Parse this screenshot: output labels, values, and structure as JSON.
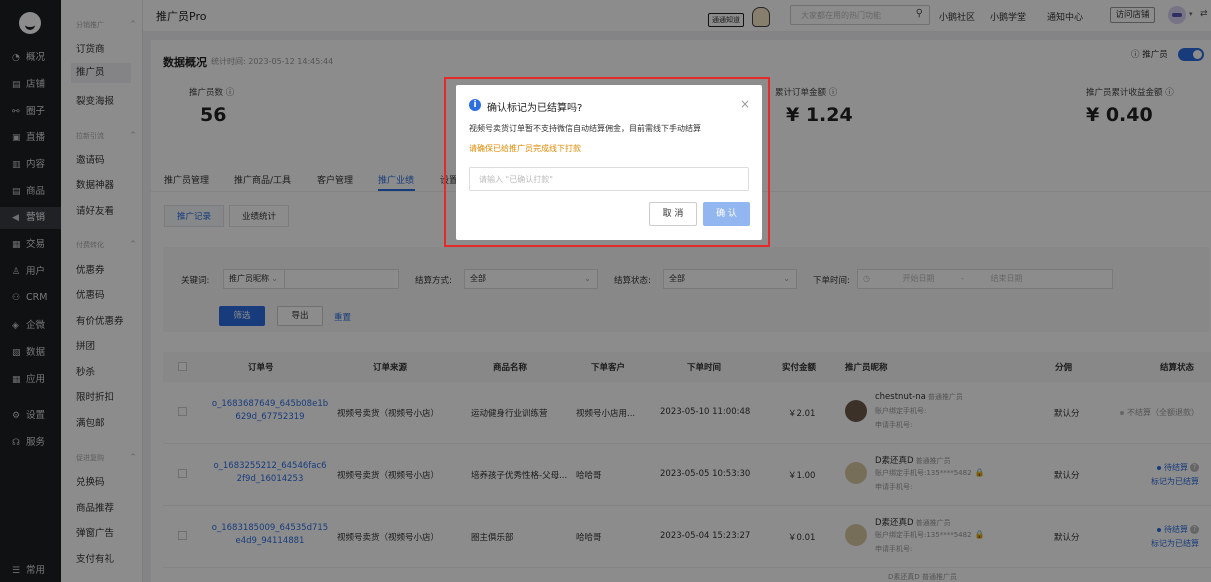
{
  "nav1": {
    "items": [
      {
        "icon": "◔",
        "label": "概况"
      },
      {
        "icon": "▤",
        "label": "店铺"
      },
      {
        "icon": "⚯",
        "label": "圈子"
      },
      {
        "icon": "▣",
        "label": "直播"
      },
      {
        "icon": "▥",
        "label": "内容"
      },
      {
        "icon": "▤",
        "label": "商品"
      },
      {
        "icon": "◀",
        "label": "营销"
      },
      {
        "icon": "▦",
        "label": "交易"
      },
      {
        "icon": "♙",
        "label": "用户"
      },
      {
        "icon": "⚇",
        "label": "CRM"
      },
      {
        "icon": "◈",
        "label": "企微"
      },
      {
        "icon": "▧",
        "label": "数据"
      },
      {
        "icon": "▦",
        "label": "应用"
      },
      {
        "icon": "⚙",
        "label": "设置"
      },
      {
        "icon": "☊",
        "label": "服务"
      }
    ],
    "bottom": {
      "icon": "☰",
      "label": "常用"
    }
  },
  "nav2": {
    "groups": [
      {
        "title": "分销推广",
        "items": [
          "订货商",
          "推广员",
          "裂变海报"
        ]
      },
      {
        "title": "拉新引流",
        "items": [
          "邀请码",
          "数据神器",
          "请好友看"
        ]
      },
      {
        "title": "付费转化",
        "items": [
          "优惠券",
          "优惠码",
          "有价优惠券",
          "拼团",
          "秒杀",
          "限时折扣",
          "满包邮"
        ]
      },
      {
        "title": "促进复购",
        "items": [
          "兑换码",
          "商品推荐",
          "弹窗广告",
          "支付有礼"
        ]
      }
    ],
    "caret": "^"
  },
  "header": {
    "title": "推广员Pro",
    "badge": "通通知道",
    "search_placeholder": "大家都在用的热门功能",
    "links": [
      "小鹅社区",
      "小鹅学堂",
      "通知中心"
    ],
    "visit_store": "访问店铺"
  },
  "overview": {
    "title": "数据概况",
    "stat_time": "统计时间: 2023-05-12 14:45:44",
    "toggle_label": "推广员",
    "stats": [
      {
        "label": "推广员数",
        "value": "56"
      },
      {
        "label": "累计订单金额",
        "value": "¥ 1.24"
      },
      {
        "label": "推广员累计收益金额",
        "value": "¥ 0.40"
      }
    ]
  },
  "tabs": [
    "推广员管理",
    "推广商品/工具",
    "客户管理",
    "推广业绩",
    "设置"
  ],
  "subtabs": [
    "推广记录",
    "业绩统计"
  ],
  "filters": {
    "keyword_label": "关键词:",
    "keyword_type": "推广员昵称",
    "settle_way_label": "结算方式:",
    "settle_way_value": "全部",
    "settle_status_label": "结算状态:",
    "settle_status_value": "全部",
    "order_time_label": "下单时间:",
    "start_placeholder": "开始日期",
    "end_placeholder": "结束日期",
    "search_btn": "筛选",
    "export_btn": "导出",
    "reset_link": "重置"
  },
  "table": {
    "headers": [
      "订单号",
      "订单来源",
      "商品名称",
      "下单客户",
      "下单时间",
      "实付金额",
      "推广员昵称",
      "分佣",
      "结算状态"
    ],
    "rows": [
      {
        "order_line1": "o_1683687649_645b08e1b",
        "order_line2": "629d_67752319",
        "source": "视频号卖货（视频号小店）",
        "product": "运动健身行业训练营",
        "customer": "视频号小店用...",
        "time": "2023-05-10 11:00:48",
        "amount": "￥2.01",
        "promoter": "chestnut-na",
        "promoter_type": "普通推广员",
        "bind_phone": "账户绑定手机号:",
        "apply_phone": "申请手机号:",
        "commission": "默认分",
        "status": "不结算（全额退款）",
        "mark": ""
      },
      {
        "order_line1": "o_1683255212_64546fac6",
        "order_line2": "2f9d_16014253",
        "source": "视频号卖货（视频号小店）",
        "product": "培养孩子优秀性格-父母...",
        "customer": "哈哈哥",
        "time": "2023-05-05 10:53:30",
        "amount": "￥1.00",
        "promoter": "D素还真D",
        "promoter_type": "普通推广员",
        "bind_phone": "账户绑定手机号:135****5482",
        "apply_phone": "申请手机号:",
        "commission": "默认分",
        "status": "待结算",
        "mark": "标记为已结算"
      },
      {
        "order_line1": "o_1683185009_64535d715",
        "order_line2": "e4d9_94114881",
        "source": "视频号卖货（视频号小店）",
        "product": "圈主俱乐部",
        "customer": "哈哈哥",
        "time": "2023-05-04 15:23:27",
        "amount": "￥0.01",
        "promoter": "D素还真D",
        "promoter_type": "普通推广员",
        "bind_phone": "账户绑定手机号:135****5482",
        "apply_phone": "申请手机号:",
        "commission": "默认分",
        "status": "待结算",
        "mark": "标记为已结算"
      }
    ],
    "partial_row_promoter": "D素还真D 普通推广员"
  },
  "modal": {
    "title": "确认标记为已结算吗?",
    "desc": "视频号卖货订单暂不支持微信自动结算佣金，目前需线下手动结算",
    "warn": "请确保已给推广员完成线下打款",
    "input_placeholder": "请输入 \"已确认打款\"",
    "cancel": "取 消",
    "ok": "确 认"
  },
  "colors": {
    "accent": "#2d6ee0",
    "warn": "#e08a00",
    "highlight": "#e62a2a"
  }
}
